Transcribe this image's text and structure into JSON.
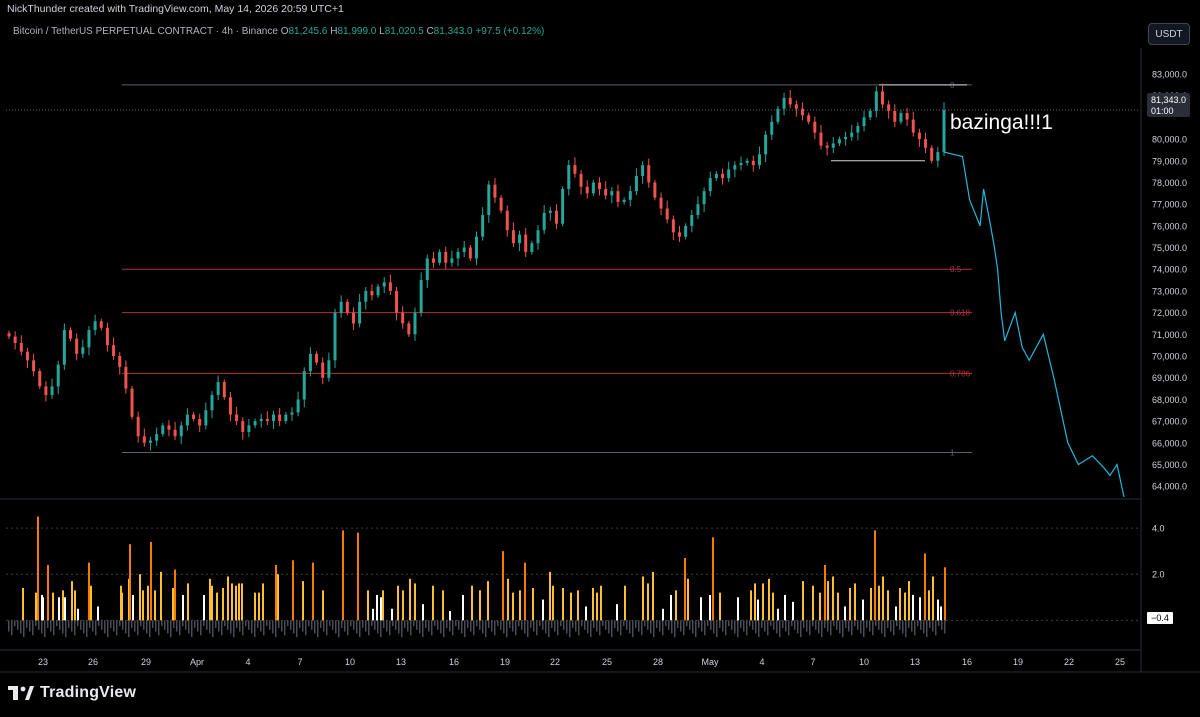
{
  "header": {
    "credit": "NickThunder created with TradingView.com, May 14, 2026 20:59 UTC+1",
    "symbol": "Bitcoin / TetherUS PERPETUAL CONTRACT · 4h · Binance",
    "o_label": "O",
    "o_value": "81,245.6",
    "h_label": "H",
    "h_value": "81,999.0",
    "l_label": "L",
    "l_value": "81,020.5",
    "c_label": "C",
    "c_value": "81,343.0",
    "change": "+97.5 (+0.12%)",
    "currency": "USDT"
  },
  "footer": {
    "brand": "TradingView"
  },
  "annotation": {
    "text": "bazinga!!!1"
  },
  "last_price": {
    "price": "81,343.0",
    "countdown": "01:00"
  },
  "indicator_last": "−0.4",
  "colors": {
    "up": "#26a69a",
    "down": "#ef5350",
    "fib": "#b2323c",
    "projection": "#22b8d9",
    "vol_orange": "#f57c00",
    "vol_yellow": "#fbc02d"
  },
  "chart_data": [
    {
      "type": "candlestick",
      "timeframe": "4h",
      "x_ticks": [
        "23",
        "26",
        "29",
        "Apr",
        "4",
        "7",
        "10",
        "13",
        "16",
        "19",
        "22",
        "25",
        "28",
        "May",
        "4",
        "7",
        "10",
        "13",
        "16",
        "19",
        "22",
        "25"
      ],
      "y_ticks": [
        "83,000.0",
        "82,000.0",
        "80,000.0",
        "79,000.0",
        "78,000.0",
        "77,000.0",
        "76,000.0",
        "75,000.0",
        "74,000.0",
        "73,000.0",
        "72,000.0",
        "71,000.0",
        "70,000.0",
        "69,000.0",
        "68,000.0",
        "67,000.0",
        "66,000.0",
        "65,000.0",
        "64,000.0"
      ],
      "ylim": [
        63500,
        84200
      ],
      "closes": [
        70900,
        70600,
        70200,
        69800,
        69300,
        68600,
        68200,
        68600,
        69600,
        71200,
        70800,
        70100,
        70400,
        71200,
        71600,
        71300,
        70500,
        70000,
        69500,
        68500,
        67200,
        66300,
        66000,
        66100,
        66400,
        66800,
        66600,
        66300,
        66800,
        67300,
        67100,
        66800,
        67500,
        68200,
        68800,
        68100,
        67300,
        67000,
        66500,
        66800,
        67000,
        67100,
        67000,
        67300,
        67000,
        67300,
        67400,
        68000,
        69300,
        70100,
        69700,
        69000,
        69800,
        72000,
        72500,
        72000,
        71500,
        72500,
        73000,
        72800,
        73200,
        73400,
        73000,
        72000,
        71500,
        71000,
        72000,
        73500,
        74500,
        74300,
        74800,
        74300,
        74500,
        74800,
        75000,
        74500,
        75500,
        76500,
        77900,
        77300,
        76700,
        75800,
        75200,
        75600,
        74800,
        75200,
        75800,
        76600,
        76700,
        76100,
        77700,
        78800,
        78400,
        77800,
        77500,
        78000,
        77700,
        77400,
        77600,
        77100,
        77200,
        77600,
        78300,
        78800,
        78000,
        77300,
        76800,
        76300,
        75700,
        75500,
        76000,
        76500,
        77000,
        77600,
        78200,
        78400,
        78200,
        78600,
        78800,
        78900,
        79000,
        78800,
        79300,
        80200,
        80800,
        81400,
        81900,
        81600,
        81400,
        81100,
        80800,
        80300,
        79700,
        79600,
        79800,
        80000,
        80100,
        80300,
        80600,
        81000,
        81300,
        82200,
        81600,
        81300,
        80800,
        81200,
        80900,
        80300,
        80000,
        79600,
        79000,
        79400,
        81343
      ],
      "fib_levels": [
        {
          "label": "0",
          "price": 82500
        },
        {
          "label": "0.5",
          "price": 74000
        },
        {
          "label": "0.618",
          "price": 72000
        },
        {
          "label": "0.786",
          "price": 69200
        },
        {
          "label": "1",
          "price": 65550
        }
      ],
      "rectangle": {
        "top": 82500,
        "bottom": 79000
      },
      "projection": [
        [
          0,
          79400
        ],
        [
          3,
          79200
        ],
        [
          5,
          77200
        ],
        [
          8,
          76000
        ],
        [
          9,
          77700
        ],
        [
          11,
          76000
        ],
        [
          12,
          75100
        ],
        [
          13,
          74000
        ],
        [
          14,
          72000
        ],
        [
          15,
          70700
        ],
        [
          18,
          72000
        ],
        [
          20,
          70400
        ],
        [
          22,
          69800
        ],
        [
          26,
          71000
        ],
        [
          29,
          69000
        ],
        [
          33,
          66000
        ],
        [
          36,
          65000
        ],
        [
          40,
          65400
        ],
        [
          43,
          64900
        ],
        [
          45,
          64500
        ],
        [
          47,
          65000
        ],
        [
          49,
          63500
        ]
      ]
    },
    {
      "type": "bar",
      "name": "volume-oscillator",
      "y_ticks": [
        "4.0",
        "2.0",
        "0.0"
      ],
      "ylim": [
        -1.2,
        5.0
      ],
      "spikes": [
        [
          20,
          1.4
        ],
        [
          33,
          1.2
        ],
        [
          35,
          4.5
        ],
        [
          39,
          1.1
        ],
        [
          40,
          1.0
        ],
        [
          45,
          2.4
        ],
        [
          50,
          1.2
        ],
        [
          56,
          1.0
        ],
        [
          60,
          1.3
        ],
        [
          62,
          1.0
        ],
        [
          69,
          1.7
        ],
        [
          72,
          1.3
        ],
        [
          75,
          0.5
        ],
        [
          86,
          2.5
        ],
        [
          88,
          1.5
        ],
        [
          95,
          0.6
        ],
        [
          118,
          1.5
        ],
        [
          119,
          1.2
        ],
        [
          126,
          1.8
        ],
        [
          127,
          3.3
        ],
        [
          130,
          1.1
        ],
        [
          137,
          2.0
        ],
        [
          140,
          1.3
        ],
        [
          145,
          1.5
        ],
        [
          148,
          3.4
        ],
        [
          152,
          1.3
        ],
        [
          158,
          2.1
        ],
        [
          170,
          1.4
        ],
        [
          172,
          2.2
        ],
        [
          180,
          1.1
        ],
        [
          185,
          1.6
        ],
        [
          201,
          1.1
        ],
        [
          207,
          1.8
        ],
        [
          209,
          1.5
        ],
        [
          214,
          1.2
        ],
        [
          220,
          1.4
        ],
        [
          225,
          1.9
        ],
        [
          229,
          1.6
        ],
        [
          233,
          1.5
        ],
        [
          236,
          1.6
        ],
        [
          239,
          1.6
        ],
        [
          252,
          1.2
        ],
        [
          256,
          1.2
        ],
        [
          260,
          1.6
        ],
        [
          273,
          2.4
        ],
        [
          275,
          2.0
        ],
        [
          290,
          2.6
        ],
        [
          300,
          1.7
        ],
        [
          310,
          2.5
        ],
        [
          320,
          1.3
        ],
        [
          340,
          3.9
        ],
        [
          355,
          3.8
        ],
        [
          365,
          1.3
        ],
        [
          370,
          0.5
        ],
        [
          374,
          1.1
        ],
        [
          378,
          1.0
        ],
        [
          380,
          1.3
        ],
        [
          389,
          0.5
        ],
        [
          395,
          1.5
        ],
        [
          400,
          1.3
        ],
        [
          407,
          1.8
        ],
        [
          412,
          1.6
        ],
        [
          420,
          0.7
        ],
        [
          430,
          1.5
        ],
        [
          440,
          1.3
        ],
        [
          447,
          0.4
        ],
        [
          460,
          1.1
        ],
        [
          469,
          1.5
        ],
        [
          477,
          1.3
        ],
        [
          485,
          1.7
        ],
        [
          500,
          3.0
        ],
        [
          505,
          1.8
        ],
        [
          510,
          1.2
        ],
        [
          517,
          1.3
        ],
        [
          522,
          2.5
        ],
        [
          530,
          1.4
        ],
        [
          540,
          0.9
        ],
        [
          547,
          2.1
        ],
        [
          550,
          1.5
        ],
        [
          560,
          1.4
        ],
        [
          568,
          1.2
        ],
        [
          575,
          1.3
        ],
        [
          583,
          0.6
        ],
        [
          590,
          1.4
        ],
        [
          594,
          1.2
        ],
        [
          598,
          1.5
        ],
        [
          614,
          0.7
        ],
        [
          622,
          1.5
        ],
        [
          640,
          1.9
        ],
        [
          645,
          1.6
        ],
        [
          650,
          2.1
        ],
        [
          660,
          0.5
        ],
        [
          668,
          1.1
        ],
        [
          673,
          1.3
        ],
        [
          682,
          2.7
        ],
        [
          685,
          1.8
        ],
        [
          698,
          1.0
        ],
        [
          707,
          1.1
        ],
        [
          710,
          3.6
        ],
        [
          717,
          1.2
        ],
        [
          735,
          1.0
        ],
        [
          748,
          1.3
        ],
        [
          752,
          1.6
        ],
        [
          755,
          0.9
        ],
        [
          760,
          1.6
        ],
        [
          766,
          1.8
        ],
        [
          770,
          1.2
        ],
        [
          775,
          0.5
        ],
        [
          782,
          1.1
        ],
        [
          790,
          0.8
        ],
        [
          800,
          1.7
        ],
        [
          810,
          1.5
        ],
        [
          817,
          1.2
        ],
        [
          822,
          2.4
        ],
        [
          825,
          1.7
        ],
        [
          830,
          1.9
        ],
        [
          835,
          1.2
        ],
        [
          842,
          0.6
        ],
        [
          847,
          1.4
        ],
        [
          852,
          1.6
        ],
        [
          860,
          0.9
        ],
        [
          868,
          1.4
        ],
        [
          872,
          3.9
        ],
        [
          876,
          1.5
        ],
        [
          880,
          1.9
        ],
        [
          885,
          1.3
        ],
        [
          893,
          0.6
        ],
        [
          897,
          1.4
        ],
        [
          902,
          1.2
        ],
        [
          906,
          1.7
        ],
        [
          910,
          1.1
        ],
        [
          917,
          1.0
        ],
        [
          922,
          2.9
        ],
        [
          926,
          1.3
        ],
        [
          930,
          1.9
        ],
        [
          935,
          0.9
        ],
        [
          938,
          0.6
        ],
        [
          942,
          2.3
        ]
      ]
    }
  ]
}
